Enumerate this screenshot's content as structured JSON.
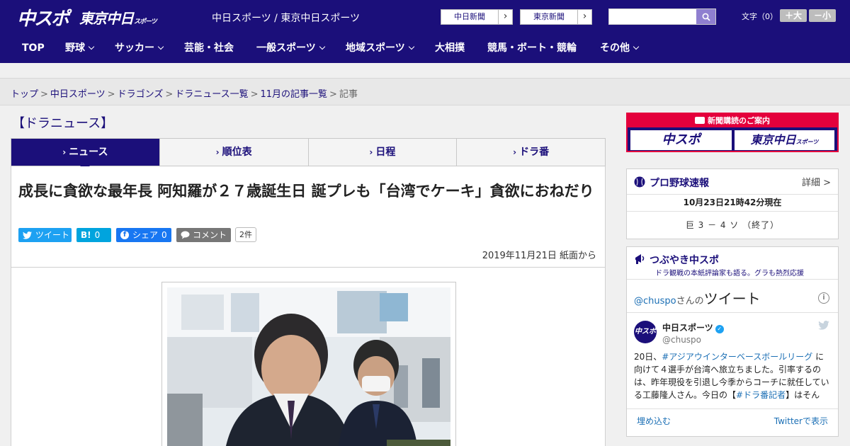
{
  "header": {
    "logo_primary": "中スポ",
    "logo_secondary": "東京中日",
    "logo_secondary_small": "スポーツ",
    "site_title": "中日スポーツ / 東京中日スポーツ",
    "paper_links": [
      {
        "label": "中日新聞"
      },
      {
        "label": "東京新聞"
      }
    ],
    "search": {
      "placeholder": ""
    },
    "font_size": {
      "label": "文字（0）",
      "increase": "＋大",
      "decrease": "－小"
    }
  },
  "nav": {
    "items": [
      {
        "label": "TOP"
      },
      {
        "label": "野球"
      },
      {
        "label": "サッカー"
      },
      {
        "label": "芸能・社会"
      },
      {
        "label": "一般スポーツ"
      },
      {
        "label": "地域スポーツ"
      },
      {
        "label": "大相撲"
      },
      {
        "label": "競馬・ボート・競輪"
      },
      {
        "label": "その他"
      }
    ]
  },
  "breadcrumb": {
    "items": [
      "トップ",
      "中日スポーツ",
      "ドラゴンズ",
      "ドラニュース一覧",
      "11月の記事一覧"
    ],
    "separator": ">",
    "current": "記事"
  },
  "section": {
    "title": "【ドラニュース】"
  },
  "tabs": [
    {
      "label": "ニュース"
    },
    {
      "label": "順位表"
    },
    {
      "label": "日程"
    },
    {
      "label": "ドラ番"
    }
  ],
  "article": {
    "headline": "成長に貪欲な最年長 阿知羅が２７歳誕生日 誕プレも「台湾でケーキ」貪欲におねだり",
    "share": {
      "tweet": "ツイート",
      "hatena_icon": "B!",
      "hatena_count": "0",
      "facebook": "シェア",
      "facebook_count": "0",
      "comment": "コメント",
      "comment_count": "2件"
    },
    "dateline": "2019年11月21日 紙面から"
  },
  "sidebar": {
    "ad": {
      "top": "新聞購読のご案内",
      "logo_left": "中スポ",
      "logo_right": "東京中日",
      "logo_right_small": "スポーツ"
    },
    "baseball": {
      "title": "プロ野球速報",
      "more": "詳細 >",
      "timestamp": "10月23日21時42分現在",
      "score": "巨 3 － 4 ソ （終了）"
    },
    "tweets": {
      "title": "つぶやき中スポ",
      "subtitle": "ドラ観戦の本紙評論家も語る。グラも熱烈応援",
      "by_handle": "@chuspo",
      "by_suffix": "さんの",
      "by_big": "ツイート",
      "avatar_text": "中スポ",
      "name": "中日スポーツ",
      "handle": "@chuspo",
      "text_1": "20日、",
      "tag_1": "#アジアウインターベースボールリーグ",
      "text_2": " に向けて４選手が台湾へ旅立ちました。引率するのは、昨年現役を引退し今季からコーチに就任している工藤隆人さん。今日の【",
      "tag_2": "#ドラ番記者",
      "text_3": "】はそんな“新米",
      "embed": "埋め込む",
      "view": "Twitterで表示"
    }
  },
  "colors": {
    "brand_navy": "#1b0f7a",
    "accent_red": "#e4003c",
    "twitter_blue": "#1da1f2",
    "facebook_blue": "#1877f2",
    "hatena_blue": "#00a4de"
  }
}
